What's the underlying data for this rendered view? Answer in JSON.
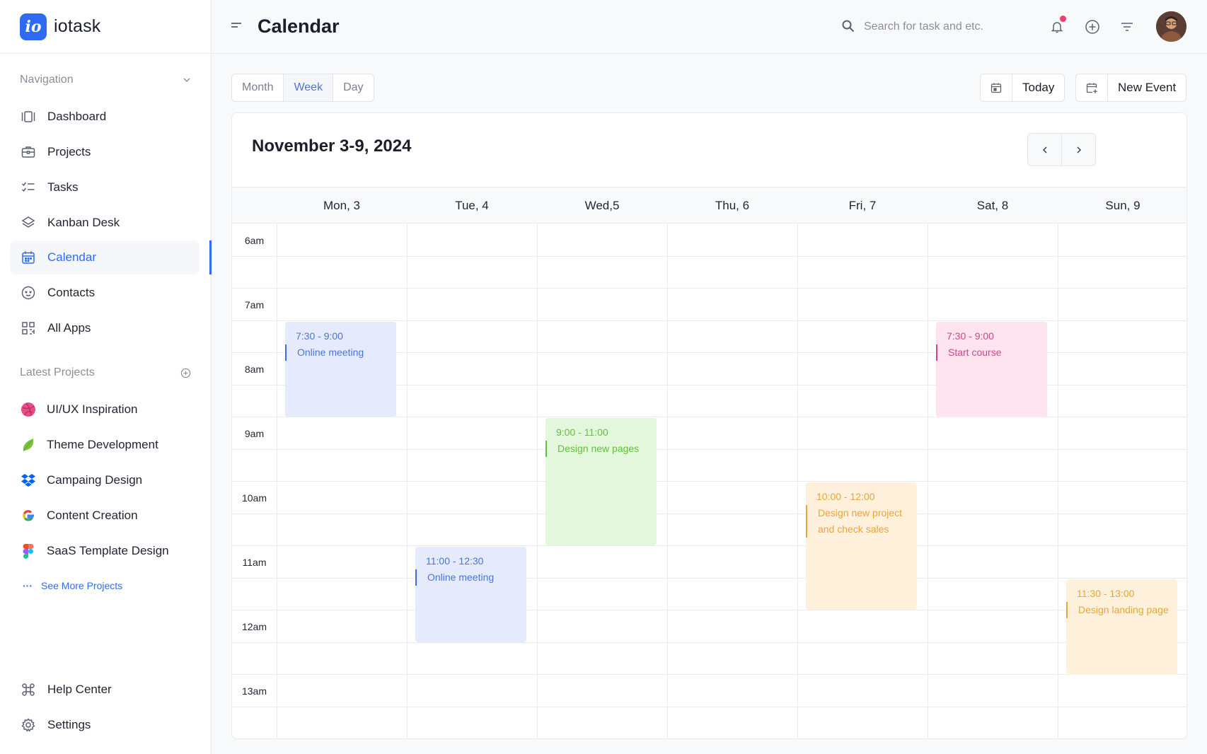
{
  "brand": {
    "logo_text": "io",
    "name": "iotask"
  },
  "sidebar": {
    "navigation_heading": "Navigation",
    "nav_items": [
      {
        "label": "Dashboard",
        "icon": "dashboard-icon"
      },
      {
        "label": "Projects",
        "icon": "briefcase-icon"
      },
      {
        "label": "Tasks",
        "icon": "checklist-icon"
      },
      {
        "label": "Kanban Desk",
        "icon": "layers-icon"
      },
      {
        "label": "Calendar",
        "icon": "calendar-icon",
        "active": true
      },
      {
        "label": "Contacts",
        "icon": "smile-icon"
      },
      {
        "label": "All Apps",
        "icon": "apps-grid-icon"
      }
    ],
    "projects_heading": "Latest Projects",
    "projects": [
      {
        "label": "UI/UX Inspiration",
        "icon": "dribbble-icon"
      },
      {
        "label": "Theme Development",
        "icon": "leaf-icon"
      },
      {
        "label": "Campaing Design",
        "icon": "dropbox-icon"
      },
      {
        "label": "Content Creation",
        "icon": "google-icon"
      },
      {
        "label": "SaaS Template Design",
        "icon": "figma-icon"
      }
    ],
    "see_more": "See More Projects",
    "bottom_items": [
      {
        "label": "Help Center",
        "icon": "command-icon"
      },
      {
        "label": "Settings",
        "icon": "gear-icon"
      }
    ]
  },
  "header": {
    "title": "Calendar",
    "search_placeholder": "Search for task and etc."
  },
  "toolbar": {
    "views": [
      "Month",
      "Week",
      "Day"
    ],
    "active_view": "Week",
    "today_label": "Today",
    "new_event_label": "New Event"
  },
  "calendar": {
    "range_title": "November 3-9, 2024",
    "days": [
      "Mon, 3",
      "Tue, 4",
      "Wed,5",
      "Thu, 6",
      "Fri, 7",
      "Sat, 8",
      "Sun, 9"
    ],
    "hours": [
      "6am",
      "7am",
      "8am",
      "9am",
      "10am",
      "11am",
      "12am",
      "13am"
    ],
    "events": [
      {
        "day": 0,
        "start": 7.5,
        "end": 9.0,
        "time": "7:30 - 9:00",
        "title": "Online meeting",
        "color": "blue"
      },
      {
        "day": 5,
        "start": 7.5,
        "end": 9.0,
        "time": "7:30 - 9:00",
        "title": "Start course",
        "color": "pink"
      },
      {
        "day": 2,
        "start": 9.0,
        "end": 11.0,
        "time": "9:00 - 11:00",
        "title": "Design new pages",
        "color": "green"
      },
      {
        "day": 4,
        "start": 10.0,
        "end": 12.0,
        "time": "10:00 - 12:00",
        "title": "Design new project and check sales",
        "color": "orange"
      },
      {
        "day": 1,
        "start": 11.0,
        "end": 12.5,
        "time": "11:00 - 12:30",
        "title": "Online meeting",
        "color": "blue"
      },
      {
        "day": 6,
        "start": 11.5,
        "end": 13.0,
        "time": "11:30 - 13:00",
        "title": "Design landing page",
        "color": "orange"
      }
    ]
  },
  "colors": {
    "accent": "#2f6bf2",
    "notification": "#ef3e6b"
  }
}
